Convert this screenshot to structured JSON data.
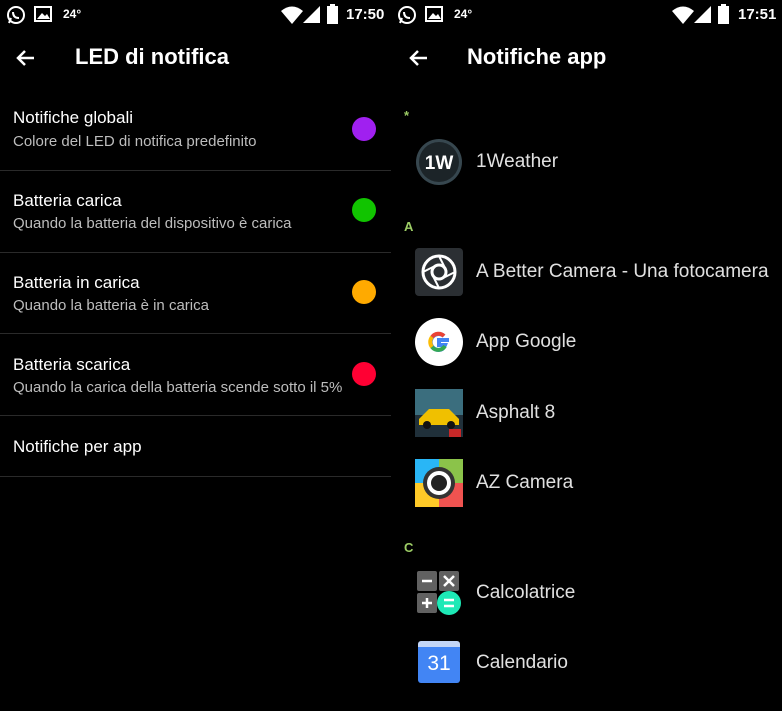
{
  "left": {
    "status": {
      "temp": "24°",
      "time": "17:50"
    },
    "title": "LED di notifica",
    "items": [
      {
        "title": "Notifiche globali",
        "subtitle": "Colore del LED di notifica predefinito",
        "color": "#a020f0"
      },
      {
        "title": "Batteria carica",
        "subtitle": "Quando la batteria del dispositivo è carica",
        "color": "#11c400"
      },
      {
        "title": "Batteria in carica",
        "subtitle": "Quando la batteria è in carica",
        "color": "#ffaa00"
      },
      {
        "title": "Batteria scarica",
        "subtitle": "Quando la carica della batteria scende sotto il 5%",
        "color": "#ff0033"
      },
      {
        "title": "Notifiche per app"
      }
    ]
  },
  "right": {
    "status": {
      "temp": "24°",
      "time": "17:51"
    },
    "title": "Notifiche app",
    "sections": [
      {
        "letter": "*",
        "apps": [
          {
            "name": "1Weather",
            "icon": "1weather-icon"
          }
        ]
      },
      {
        "letter": "A",
        "apps": [
          {
            "name": "A Better Camera - Una fotocamera",
            "icon": "better-camera-icon"
          },
          {
            "name": "App Google",
            "icon": "google-icon"
          },
          {
            "name": "Asphalt 8",
            "icon": "asphalt-icon"
          },
          {
            "name": "AZ Camera",
            "icon": "az-camera-icon"
          }
        ]
      },
      {
        "letter": "C",
        "apps": [
          {
            "name": "Calcolatrice",
            "icon": "calculator-icon"
          },
          {
            "name": "Calendario",
            "icon": "calendar-icon",
            "icon_text": "31"
          }
        ]
      }
    ]
  }
}
